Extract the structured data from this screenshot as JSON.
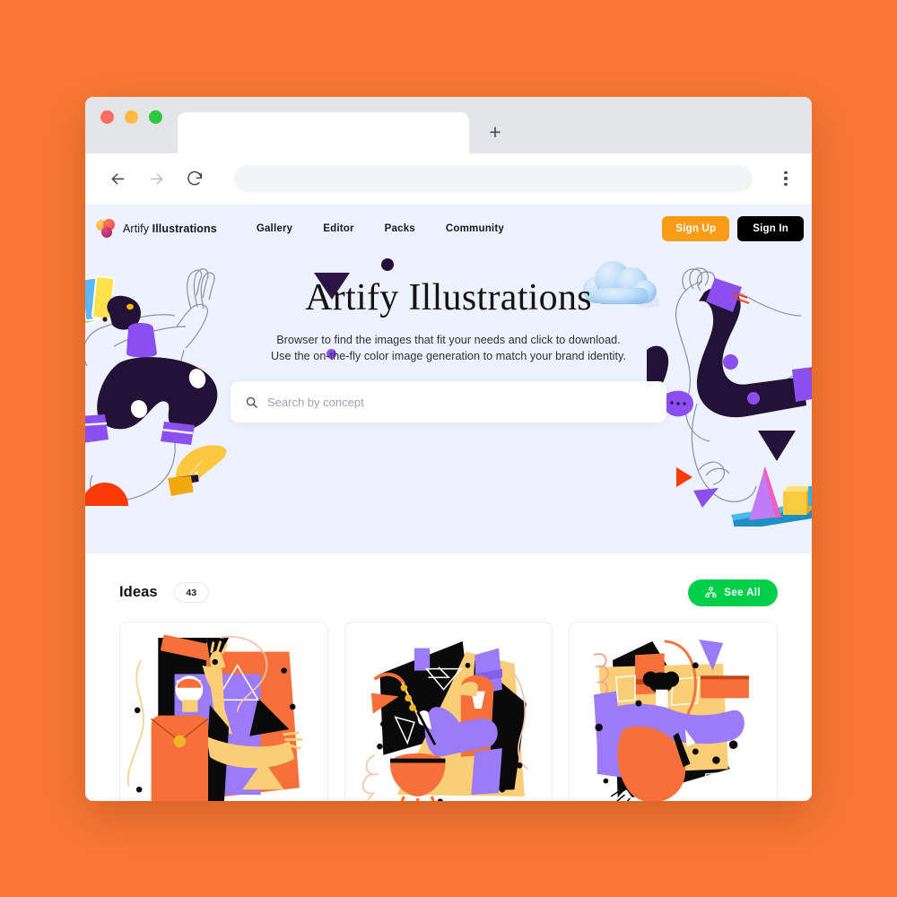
{
  "page": {
    "background_color": "#F97833"
  },
  "browser": {
    "tab": {
      "title": "",
      "new_tab_label": "+"
    },
    "toolbar": {
      "back_icon": "arrow-left-icon",
      "forward_icon": "arrow-right-icon",
      "reload_icon": "reload-icon",
      "url_value": "",
      "url_placeholder": "",
      "menu_icon": "kebab-menu-icon"
    },
    "window_controls": [
      "close",
      "minimize",
      "maximize"
    ]
  },
  "site": {
    "brand": {
      "prefix": "Artify ",
      "name": "Illustrations",
      "logo_icon": "artify-logo-icon"
    },
    "nav_links": [
      {
        "label": "Gallery"
      },
      {
        "label": "Editor"
      },
      {
        "label": "Packs"
      },
      {
        "label": "Community"
      }
    ],
    "actions": {
      "sign_up": "Sign Up",
      "sign_in": "Sign In",
      "sign_up_color": "#FB9C16",
      "sign_in_color": "#000000"
    }
  },
  "hero": {
    "title": "Artify Illustrations",
    "subtitle_line1": "Browser to find the images that fit your needs and click to download.",
    "subtitle_line2": "Use the on-the-fly color image generation to match your brand identity.",
    "search": {
      "placeholder": "Search by concept",
      "value": "",
      "icon": "search-icon"
    },
    "background_color": "#EEF1FE"
  },
  "ideas": {
    "title": "Ideas",
    "count": "43",
    "see_all": {
      "label": "See All",
      "icon": "sitemap-icon",
      "color": "#00CF49"
    },
    "cards": [
      {
        "alt": "abstract figure with orange bag illustration"
      },
      {
        "alt": "abstract figure cooking over orange pot illustration"
      },
      {
        "alt": "abstract seated figure with yellow blocks illustration"
      }
    ]
  },
  "palette": {
    "orange": "#F97833",
    "lavender_bg": "#EEF1FE",
    "dark_purple": "#2B1446",
    "purple": "#8B5CF6",
    "yellow": "#FBC550",
    "red_orange": "#FB3A0A"
  }
}
